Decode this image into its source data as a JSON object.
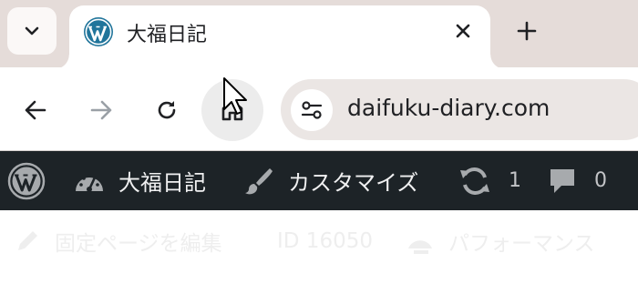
{
  "browser": {
    "tab": {
      "title": "大福日記",
      "favicon": "wordpress-icon"
    },
    "address_bar": {
      "url": "daifuku-diary.com"
    },
    "icons": {
      "tab_list": "chevron-down-icon",
      "close_tab": "close-icon",
      "new_tab": "plus-icon",
      "back": "arrow-left-icon",
      "forward": "arrow-right-icon",
      "reload": "reload-icon",
      "home": "home-icon",
      "site_info": "tune-icon"
    }
  },
  "admin_bar": {
    "site_name": "大福日記",
    "customize_label": "カスタマイズ",
    "updates_count": "1",
    "comments_count": "0",
    "icons": {
      "logo": "wordpress-icon",
      "dashboard": "dashboard-gauge-icon",
      "customize": "paintbrush-icon",
      "updates": "update-icon",
      "comments": "comment-bubble-icon"
    }
  },
  "page_toolbar": {
    "edit_label": "固定ページを編集",
    "id_label": "ID 16050",
    "performance_label": "パフォーマンス"
  },
  "colors": {
    "tab_strip": "#e5dcd9",
    "admin_bar": "#1d2327",
    "wordpress_blue": "#21759b",
    "omnibox": "#ebe6e4"
  }
}
